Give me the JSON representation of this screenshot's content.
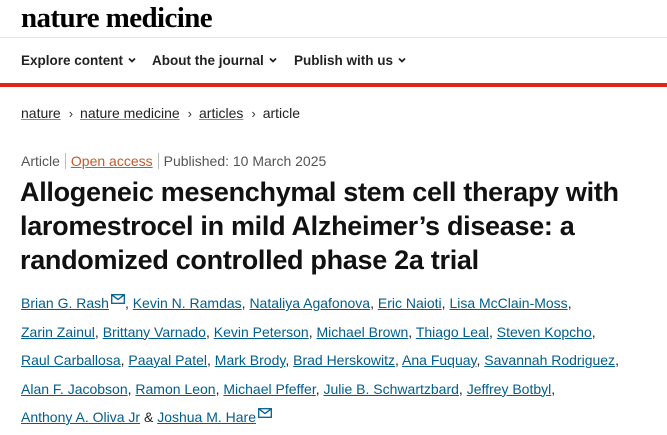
{
  "header": {
    "logo": "nature medicine"
  },
  "nav": {
    "items": [
      {
        "label": "Explore content"
      },
      {
        "label": "About the journal"
      },
      {
        "label": "Publish with us"
      }
    ]
  },
  "breadcrumb": {
    "items": [
      "nature",
      "nature medicine",
      "articles"
    ],
    "current": "article"
  },
  "article": {
    "type": "Article",
    "access": "Open access",
    "published": "Published: 10 March 2025",
    "title": "Allogeneic mesenchymal stem cell therapy with laromestrocel in mild Alzheimer’s disease: a randomized controlled phase 2a trial"
  },
  "authors": [
    "Brian G. Rash",
    "Kevin N. Ramdas",
    "Nataliya Agafonova",
    "Eric Naioti",
    "Lisa McClain-Moss",
    "Zarin Zainul",
    "Brittany Varnado",
    "Kevin Peterson",
    "Michael Brown",
    "Thiago Leal",
    "Steven Kopcho",
    "Raul Carballosa",
    "Paayal Patel",
    "Mark Brody",
    "Brad Herskowitz",
    "Ana Fuquay",
    "Savannah Rodriguez",
    "Alan F. Jacobson",
    "Ramon Leon",
    "Michael Pfeffer",
    "Julie B. Schwartzbard",
    "Jeffrey Botbyl",
    "Anthony A. Oliva Jr",
    "Joshua M. Hare"
  ],
  "authors_conjunction": "&",
  "colors": {
    "accent_red": "#e2231a",
    "link_blue": "#025e8d",
    "open_access": "#c05b2b"
  }
}
